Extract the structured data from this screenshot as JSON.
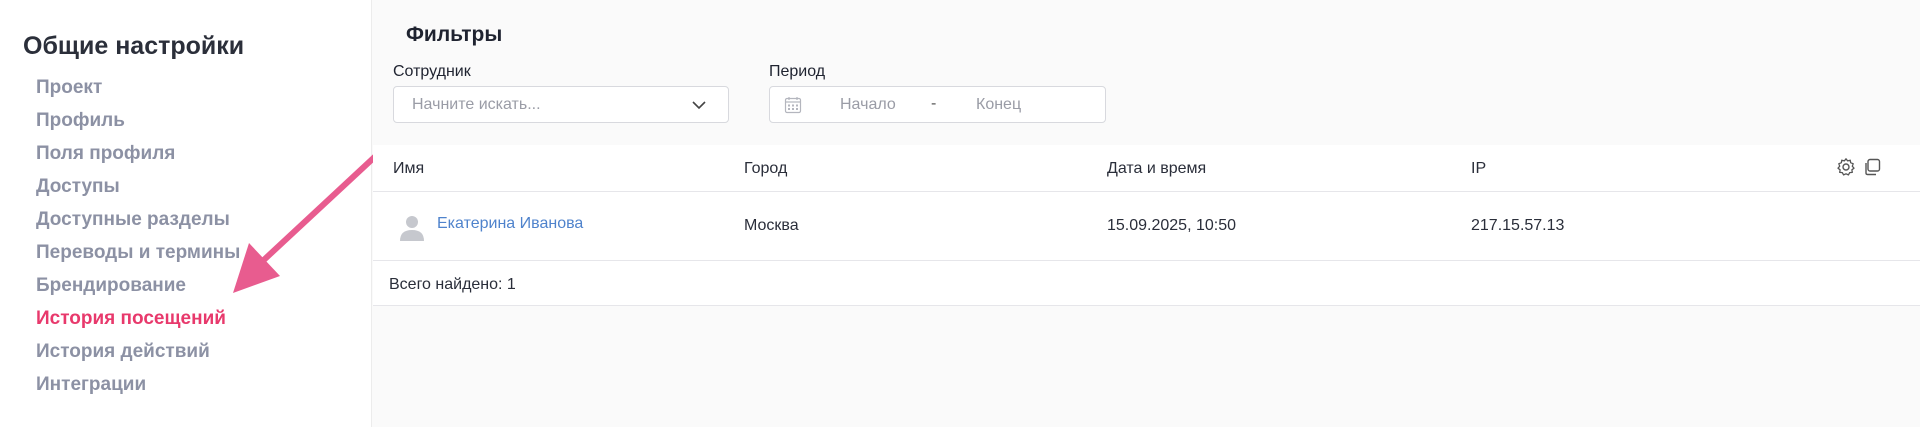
{
  "sidebar": {
    "title": "Общие настройки",
    "items": [
      {
        "label": "Проект"
      },
      {
        "label": "Профиль"
      },
      {
        "label": "Поля профиля"
      },
      {
        "label": "Доступы"
      },
      {
        "label": "Доступные разделы"
      },
      {
        "label": "Переводы и термины"
      },
      {
        "label": "Брендирование"
      },
      {
        "label": "История посещений",
        "active": true
      },
      {
        "label": "История действий"
      },
      {
        "label": "Интеграции"
      }
    ]
  },
  "filters": {
    "title": "Фильтры",
    "employee": {
      "label": "Сотрудник",
      "placeholder": "Начните искать..."
    },
    "period": {
      "label": "Период",
      "start_placeholder": "Начало",
      "separator": "-",
      "end_placeholder": "Конец"
    }
  },
  "table": {
    "columns": [
      "Имя",
      "Город",
      "Дата и время",
      "IP"
    ],
    "rows": [
      {
        "name": "Екатерина Иванова",
        "city": "Москва",
        "datetime": "15.09.2025, 10:50",
        "ip": "217.15.57.13"
      }
    ],
    "total": "Всего найдено: 1"
  },
  "colors": {
    "accent": "#e8396c",
    "link": "#4f83cc",
    "nav_text": "#8c91a4",
    "arrow": "#e85c8f"
  },
  "icons": [
    "chevron-down-icon",
    "calendar-icon",
    "gear-icon",
    "copy-icon",
    "avatar-placeholder-icon"
  ]
}
